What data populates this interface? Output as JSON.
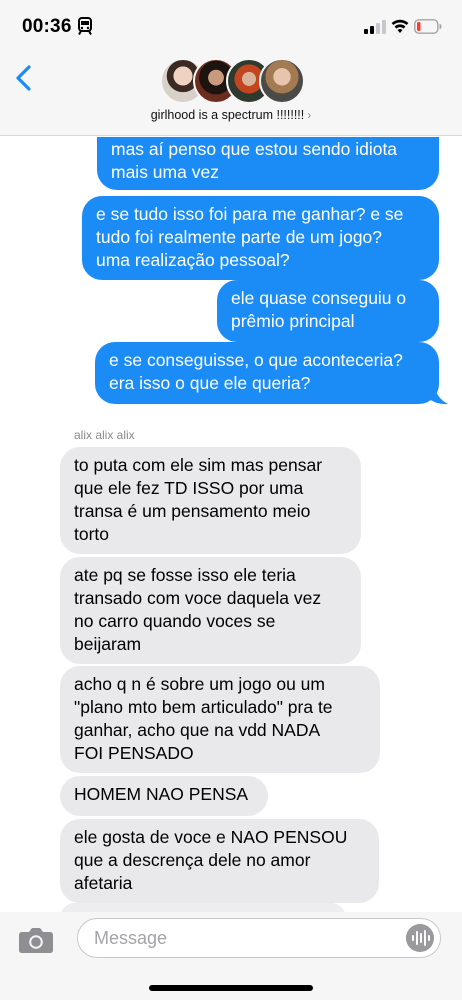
{
  "status_bar": {
    "time": "00:36",
    "train_icon": "train-icon",
    "signal_icon": "cellular-signal-icon",
    "wifi_icon": "wifi-icon",
    "battery_icon": "battery-low-icon",
    "battery_color": "#ff3b30"
  },
  "header": {
    "back_icon": "chevron-left-icon",
    "group_name": "girlhood is a spectrum !!!!!!!!",
    "chevron": "›",
    "accent_color": "#1b8cf6"
  },
  "messages": [
    {
      "type": "sent",
      "lines": [
        "mas aí penso que estou sendo idiota",
        "mais uma vez"
      ]
    },
    {
      "type": "sent",
      "lines": [
        "e se tudo isso foi para me ganhar? e se",
        "tudo foi realmente parte de um jogo?",
        "uma realização pessoal?"
      ]
    },
    {
      "type": "sent",
      "lines": [
        "ele quase conseguiu o",
        "prêmio principal"
      ]
    },
    {
      "type": "sent",
      "lines": [
        "e se conseguisse, o que aconteceria?",
        "era isso o que ele queria?"
      ]
    },
    {
      "type": "recv",
      "lines": [
        "to puta com ele sim mas pensar",
        "que ele fez TD ISSO por uma",
        "transa é um pensamento meio",
        "torto"
      ]
    },
    {
      "type": "recv",
      "lines": [
        "ate pq se fosse isso ele teria",
        "transado com voce daquela vez",
        "no carro quando voces se",
        "beijaram"
      ]
    },
    {
      "type": "recv",
      "lines": [
        "acho q n é sobre um jogo ou um",
        "\"plano mto bem articulado\" pra te",
        "ganhar, acho que na vdd NADA",
        "FOI PENSADO"
      ]
    },
    {
      "type": "recv",
      "lines": [
        "HOMEM NAO PENSA"
      ]
    },
    {
      "type": "recv",
      "lines": [
        "ele gosta de voce e NAO PENSOU",
        "que a descrença dele no amor",
        "afetaria"
      ]
    }
  ],
  "sender_name": "alix alix alix",
  "input": {
    "placeholder": "Message",
    "camera_icon": "camera-icon",
    "audio_icon": "audio-waveform-icon"
  }
}
